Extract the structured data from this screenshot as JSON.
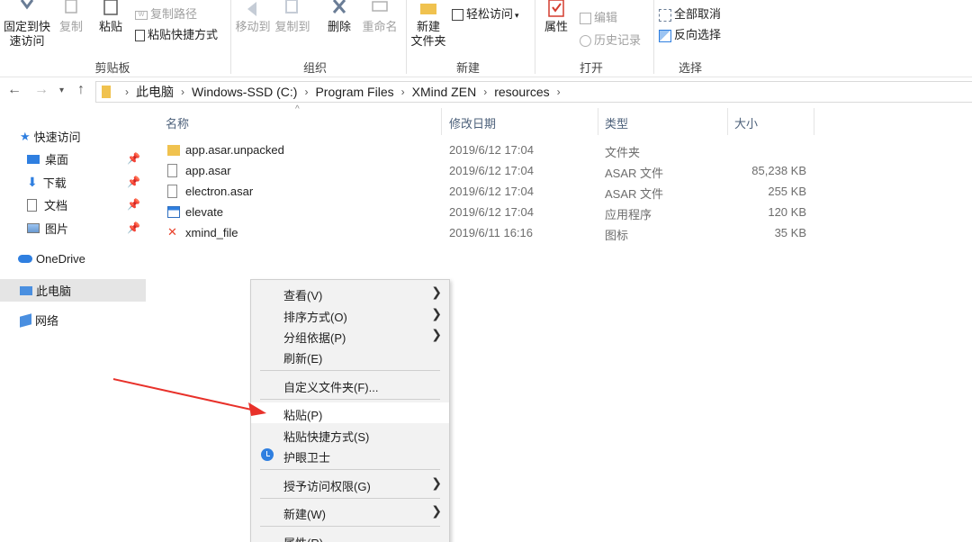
{
  "ribbon": {
    "pin_quick_access": "固定到快\n速访问",
    "copy": "复制",
    "paste": "粘贴",
    "copy_path": "复制路径",
    "paste_shortcut": "粘贴快捷方式",
    "group_clipboard": "剪贴板",
    "move_to": "移动到",
    "copy_to": "复制到",
    "delete": "删除",
    "rename": "重命名",
    "group_organize": "组织",
    "new_folder": "新建\n文件夹",
    "easy_access": "轻松访问",
    "group_new": "新建",
    "properties": "属性",
    "edit": "编辑",
    "history": "历史记录",
    "group_open": "打开",
    "select_none": "全部取消",
    "invert_selection": "反向选择",
    "group_select": "选择"
  },
  "address": {
    "crumbs": [
      "此电脑",
      "Windows-SSD (C:)",
      "Program Files",
      "XMind ZEN",
      "resources"
    ]
  },
  "sidebar": {
    "quick_access": "快速访问",
    "items": [
      {
        "label": "桌面"
      },
      {
        "label": "下载"
      },
      {
        "label": "文档"
      },
      {
        "label": "图片"
      }
    ],
    "onedrive": "OneDrive",
    "this_pc": "此电脑",
    "network": "网络"
  },
  "columns": {
    "name": "名称",
    "date": "修改日期",
    "type": "类型",
    "size": "大小"
  },
  "files": [
    {
      "name": "app.asar.unpacked",
      "date": "2019/6/12 17:04",
      "type": "文件夹",
      "size": "",
      "icon": "folder-icon"
    },
    {
      "name": "app.asar",
      "date": "2019/6/12 17:04",
      "type": "ASAR 文件",
      "size": "85,238 KB",
      "icon": "file-icon"
    },
    {
      "name": "electron.asar",
      "date": "2019/6/12 17:04",
      "type": "ASAR 文件",
      "size": "255 KB",
      "icon": "file-icon"
    },
    {
      "name": "elevate",
      "date": "2019/6/12 17:04",
      "type": "应用程序",
      "size": "120 KB",
      "icon": "app-icon"
    },
    {
      "name": "xmind_file",
      "date": "2019/6/11 16:16",
      "type": "图标",
      "size": "35 KB",
      "icon": "xmind-icon"
    }
  ],
  "context_menu": {
    "view": "查看(V)",
    "sort_by": "排序方式(O)",
    "group_by": "分组依据(P)",
    "refresh": "刷新(E)",
    "customize": "自定义文件夹(F)...",
    "paste": "粘贴(P)",
    "paste_shortcut": "粘贴快捷方式(S)",
    "eye_guard": "护眼卫士",
    "grant_access": "授予访问权限(G)",
    "new": "新建(W)",
    "properties": "属性(R)"
  },
  "colors": {
    "accent": "#2f7fe0",
    "annotation_arrow": "#e8312a",
    "folder": "#f0c24f"
  }
}
